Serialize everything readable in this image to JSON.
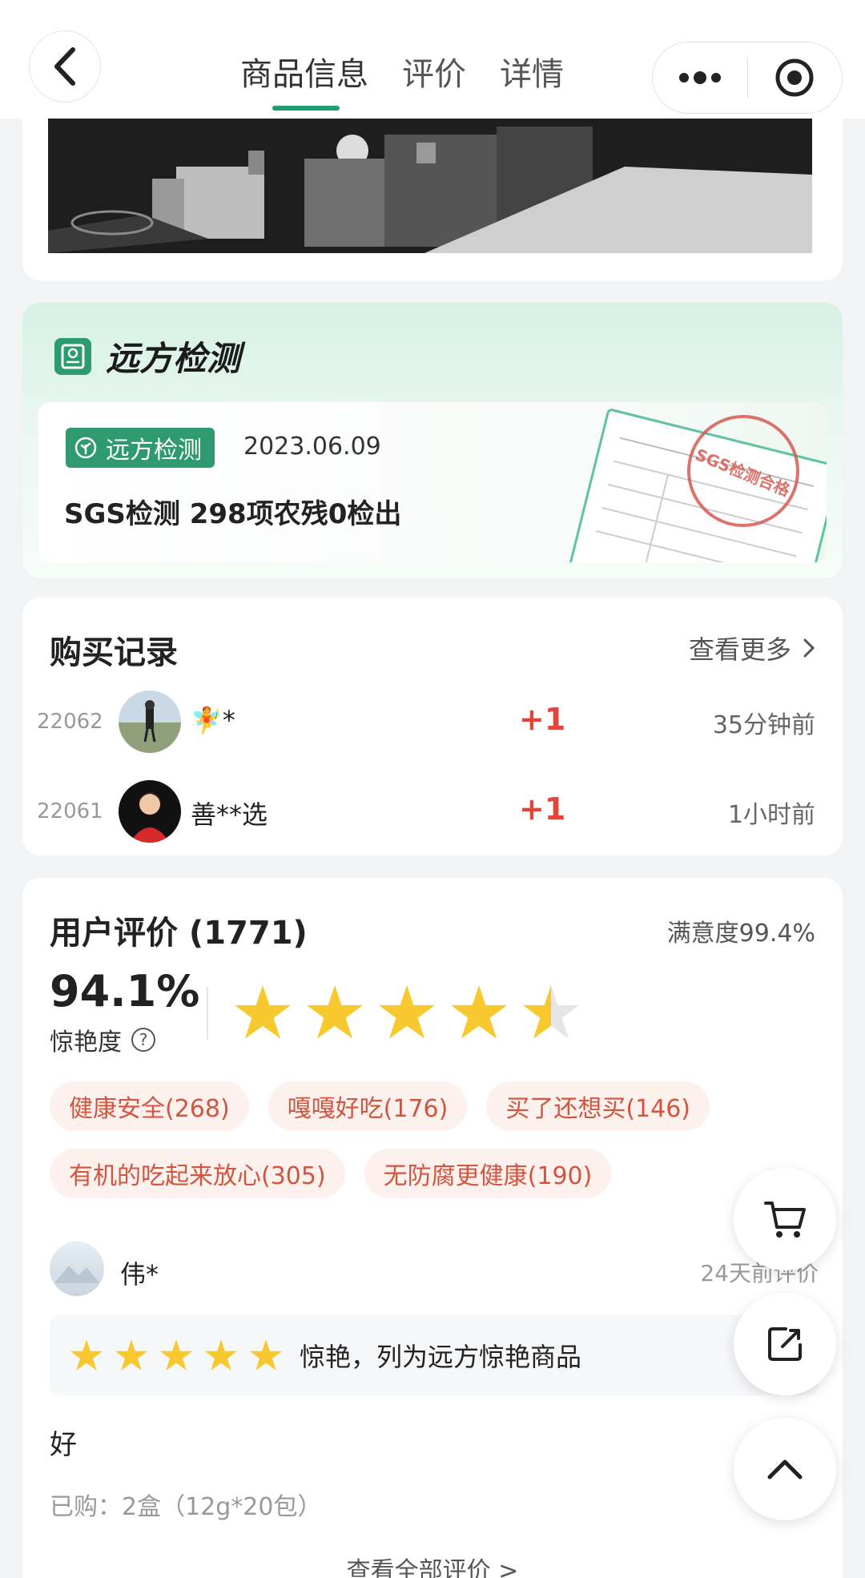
{
  "nav": {
    "tabs": [
      {
        "label": "商品信息",
        "active": true
      },
      {
        "label": "评价",
        "active": false
      },
      {
        "label": "详情",
        "active": false
      }
    ],
    "accent_color": "#1f9d6e"
  },
  "inspection": {
    "section_title": "远方检测",
    "badge_label": "远方检测",
    "date": "2023.06.09",
    "description": "SGS检测  298项农残0检出",
    "stamp_text": "SGS检测合格"
  },
  "purchase_records": {
    "title": "购买记录",
    "see_more": "查看更多",
    "items": [
      {
        "number": "22062",
        "name": "*",
        "plus": "+1",
        "time": "35分钟前"
      },
      {
        "number": "22061",
        "name": "善**选",
        "plus": "+1",
        "time": "1小时前"
      }
    ]
  },
  "reviews": {
    "title": "用户评价 (1771)",
    "satisfaction": "满意度99.4%",
    "score": "94.1%",
    "score_label": "惊艳度",
    "star_rating": 4.5,
    "tags": [
      "健康安全(268)",
      "嘎嘎好吃(176)",
      "买了还想买(146)",
      "有机的吃起来放心(305)",
      "无防腐更健康(190)"
    ],
    "review": {
      "reviewer": "伟*",
      "time": "24天前评价",
      "stars": 5,
      "rating_text": "惊艳，列为远方惊艳商品",
      "body": "好",
      "bought": "已购：2盒（12g*20包）"
    },
    "view_all": "查看全部评价 >"
  },
  "icons": {
    "back": "chevron-left-icon",
    "more": "more-dots-icon",
    "close": "target-circle-icon",
    "cart": "cart-icon",
    "share": "share-icon",
    "top": "chevron-up-icon"
  }
}
